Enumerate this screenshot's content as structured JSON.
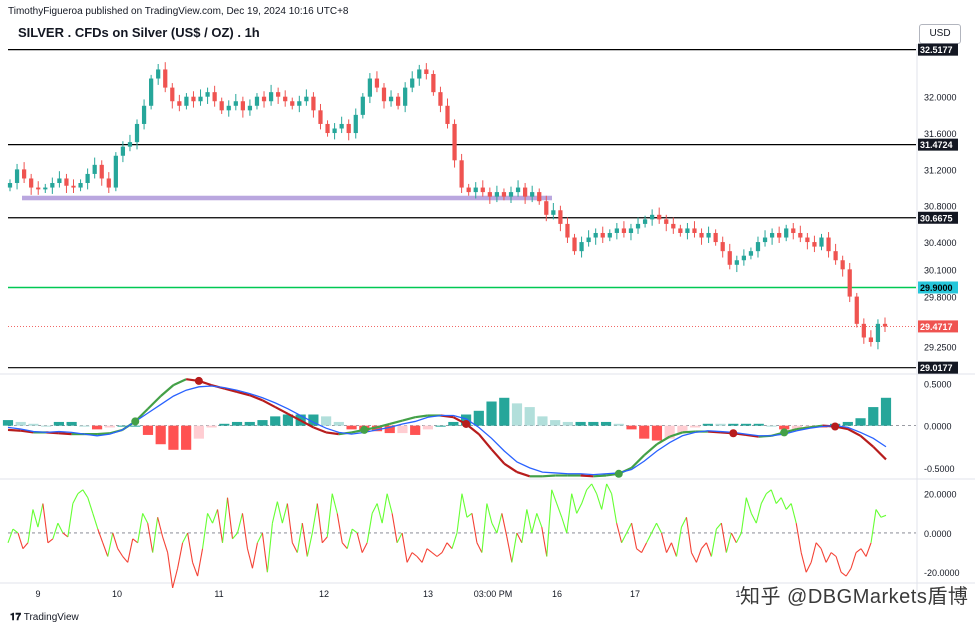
{
  "header": {
    "published": "TimothyFigueroa published on TradingView.com, Dec 19, 2024 10:16 UTC+8",
    "title": "SILVER . CFDs on Silver (US$ / OZ) . 1h",
    "currency": "USD",
    "footer": "TradingView",
    "watermark": "知乎 @DBGMarkets盾博"
  },
  "colors": {
    "up": "#26a69a",
    "down": "#ef5350",
    "support_zone": "#b39ddb",
    "level_green": "#00c853",
    "macd_line": "#2962ff",
    "signal_line": "#b71c1c",
    "signal_up": "#43a047",
    "osc_up": "#66ff33",
    "osc_down": "#f44336"
  },
  "chart_data": [
    {
      "type": "candlestick",
      "title": "SILVER . CFDs on Silver (US$ / OZ) . 1h",
      "ylim": [
        28.97,
        32.58
      ],
      "price_ticks": [
        "32.0000",
        "31.6000",
        "31.2000",
        "30.8000",
        "30.4000",
        "30.1000",
        "29.8000",
        "29.2500"
      ],
      "price_tick_values": [
        32.0,
        31.6,
        31.2,
        30.8,
        30.4,
        30.1,
        29.8,
        29.25
      ],
      "x_labels": [
        "9",
        "10",
        "11",
        "12",
        "13",
        "03:00 PM",
        "16",
        "17",
        "1"
      ],
      "horizontal_levels": [
        {
          "label": "32.5177",
          "value": 32.5177,
          "color": "#000000"
        },
        {
          "label": "31.4724",
          "value": 31.4724,
          "color": "#000000"
        },
        {
          "label": "30.6675",
          "value": 30.6675,
          "color": "#000000"
        },
        {
          "label": "29.9000",
          "value": 29.9,
          "color": "#00c853"
        },
        {
          "label": "29.0177",
          "value": 29.0177,
          "color": "#000000"
        }
      ],
      "current_price": {
        "label": "29.4717",
        "value": 29.4717
      },
      "support_zone": {
        "low": 30.86,
        "high": 30.91
      },
      "close_series": [
        31.05,
        31.2,
        31.1,
        31.0,
        30.98,
        31.0,
        31.05,
        31.1,
        31.02,
        31.0,
        31.05,
        31.15,
        31.25,
        31.1,
        31.0,
        31.35,
        31.45,
        31.5,
        31.7,
        31.9,
        32.2,
        32.3,
        32.1,
        31.95,
        31.9,
        32.0,
        31.95,
        32.0,
        32.05,
        31.95,
        31.85,
        31.9,
        31.95,
        31.85,
        31.9,
        32.0,
        31.95,
        32.05,
        32.0,
        31.95,
        31.9,
        31.95,
        32.0,
        31.85,
        31.7,
        31.6,
        31.65,
        31.7,
        31.6,
        31.8,
        32.0,
        32.2,
        32.1,
        31.95,
        32.0,
        31.9,
        32.1,
        32.2,
        32.3,
        32.25,
        32.05,
        31.9,
        31.7,
        31.3,
        31.0,
        30.95,
        31.0,
        30.95,
        30.9,
        30.95,
        30.9,
        30.95,
        31.0,
        30.9,
        30.95,
        30.85,
        30.7,
        30.75,
        30.6,
        30.45,
        30.3,
        30.4,
        30.45,
        30.5,
        30.45,
        30.5,
        30.55,
        30.5,
        30.55,
        30.6,
        30.65,
        30.7,
        30.65,
        30.6,
        30.55,
        30.5,
        30.55,
        30.5,
        30.45,
        30.5,
        30.4,
        30.3,
        30.15,
        30.2,
        30.25,
        30.3,
        30.4,
        30.45,
        30.5,
        30.45,
        30.55,
        30.5,
        30.45,
        30.4,
        30.35,
        30.45,
        30.3,
        30.2,
        30.1,
        29.8,
        29.5,
        29.35,
        29.3,
        29.5,
        29.47
      ],
      "candle_body_min": 0.05
    },
    {
      "type": "line",
      "name_hidden": true,
      "ylim": [
        -0.62,
        0.6
      ],
      "ticks": [
        "0.5000",
        "0.0000",
        "-0.5000"
      ],
      "tick_values": [
        0.5,
        0.0,
        -0.5
      ],
      "macd": [
        -0.02,
        -0.04,
        -0.07,
        -0.08,
        -0.07,
        -0.08,
        -0.1,
        -0.12,
        -0.1,
        -0.05,
        0.05,
        0.15,
        0.25,
        0.35,
        0.42,
        0.46,
        0.47,
        0.45,
        0.42,
        0.38,
        0.33,
        0.27,
        0.2,
        0.12,
        0.04,
        -0.03,
        -0.08,
        -0.1,
        -0.08,
        -0.05,
        -0.02,
        0.02,
        0.05,
        0.1,
        0.12,
        0.12,
        0.08,
        -0.02,
        -0.15,
        -0.3,
        -0.43,
        -0.5,
        -0.55,
        -0.56,
        -0.57,
        -0.57,
        -0.58,
        -0.57,
        -0.56,
        -0.52,
        -0.42,
        -0.3,
        -0.2,
        -0.12,
        -0.08,
        -0.06,
        -0.07,
        -0.08,
        -0.1,
        -0.12,
        -0.12,
        -0.1,
        -0.06,
        -0.03,
        -0.01,
        0.0,
        -0.02,
        -0.08,
        -0.15,
        -0.25
      ],
      "signal": [
        -0.05,
        -0.06,
        -0.08,
        -0.08,
        -0.09,
        -0.1,
        -0.1,
        -0.1,
        -0.09,
        -0.05,
        0.05,
        0.2,
        0.35,
        0.48,
        0.55,
        0.53,
        0.48,
        0.44,
        0.4,
        0.36,
        0.3,
        0.22,
        0.14,
        0.06,
        -0.02,
        -0.08,
        -0.1,
        -0.08,
        -0.05,
        -0.02,
        0.02,
        0.06,
        0.1,
        0.12,
        0.12,
        0.1,
        0.02,
        -0.1,
        -0.28,
        -0.45,
        -0.55,
        -0.6,
        -0.6,
        -0.59,
        -0.59,
        -0.59,
        -0.6,
        -0.59,
        -0.57,
        -0.5,
        -0.35,
        -0.22,
        -0.13,
        -0.08,
        -0.07,
        -0.07,
        -0.08,
        -0.09,
        -0.11,
        -0.13,
        -0.12,
        -0.08,
        -0.04,
        -0.02,
        0.0,
        -0.01,
        -0.04,
        -0.12,
        -0.25,
        -0.4
      ],
      "cross_markers": [
        {
          "index": 10,
          "color": "#43a047"
        },
        {
          "index": 15,
          "color": "#b71c1c"
        },
        {
          "index": 28,
          "color": "#43a047"
        },
        {
          "index": 36,
          "color": "#b71c1c"
        },
        {
          "index": 48,
          "color": "#43a047"
        },
        {
          "index": 57,
          "color": "#b71c1c"
        },
        {
          "index": 61,
          "color": "#43a047"
        },
        {
          "index": 65,
          "color": "#b71c1c"
        }
      ]
    },
    {
      "type": "line",
      "name_hidden": true,
      "ylim": [
        -25,
        27
      ],
      "ticks": [
        "20.0000",
        "0.0000",
        "-20.0000"
      ],
      "tick_values": [
        20,
        0,
        -20
      ],
      "values": [
        -5,
        2,
        0,
        -8,
        -5,
        12,
        3,
        15,
        -5,
        -3,
        5,
        0,
        -2,
        15,
        20,
        22,
        18,
        10,
        2,
        -5,
        -12,
        0,
        -8,
        -12,
        -15,
        -3,
        -5,
        10,
        5,
        -10,
        8,
        -2,
        -10,
        -28,
        -18,
        -5,
        0,
        -15,
        -22,
        -8,
        10,
        5,
        12,
        -5,
        18,
        -3,
        0,
        10,
        -8,
        -18,
        -5,
        0,
        -20,
        5,
        16,
        5,
        15,
        -5,
        -10,
        5,
        -12,
        0,
        15,
        -5,
        -2,
        20,
        10,
        -5,
        -8,
        2,
        0,
        -10,
        -5,
        10,
        15,
        5,
        20,
        10,
        -5,
        0,
        -15,
        -10,
        -12,
        -15,
        -8,
        -10,
        -12,
        -10,
        -5,
        -8,
        0,
        20,
        8,
        10,
        -5,
        -10,
        15,
        5,
        0,
        10,
        -2,
        -15,
        0,
        -5,
        12,
        0,
        10,
        3,
        -12,
        22,
        15,
        8,
        0,
        20,
        10,
        15,
        22,
        25,
        20,
        12,
        25,
        20,
        5,
        -5,
        0,
        5,
        -8,
        -10,
        -5,
        0,
        5,
        0,
        -10,
        -5,
        -12,
        3,
        8,
        -10,
        -15,
        -8,
        -5,
        -12,
        2,
        5,
        -10,
        0,
        -5,
        0,
        18,
        10,
        5,
        15,
        20,
        22,
        15,
        18,
        12,
        15,
        5,
        -10,
        -20,
        -15,
        -5,
        -8,
        -15,
        -10,
        -12,
        -20,
        -22,
        -18,
        -10,
        -8,
        -12,
        -5,
        12,
        8,
        9
      ]
    }
  ]
}
